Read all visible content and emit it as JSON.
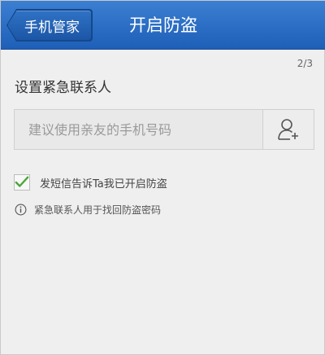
{
  "header": {
    "back_label": "手机管家",
    "title": "开启防盗"
  },
  "step_indicator": "2/3",
  "section_title": "设置紧急联系人",
  "phone_field": {
    "value": "",
    "placeholder": "建议使用亲友的手机号码"
  },
  "sms_checkbox": {
    "checked": true,
    "label": "发短信告诉Ta我已开启防盗"
  },
  "info_note": "紧急联系人用于找回防盗密码",
  "icons": {
    "back": "back-arrow-button",
    "contact": "add-contact-icon",
    "check": "checkmark-icon",
    "info": "info-icon"
  },
  "colors": {
    "header": "#2a6cc4",
    "check": "#4aa63a",
    "background": "#efefef"
  }
}
